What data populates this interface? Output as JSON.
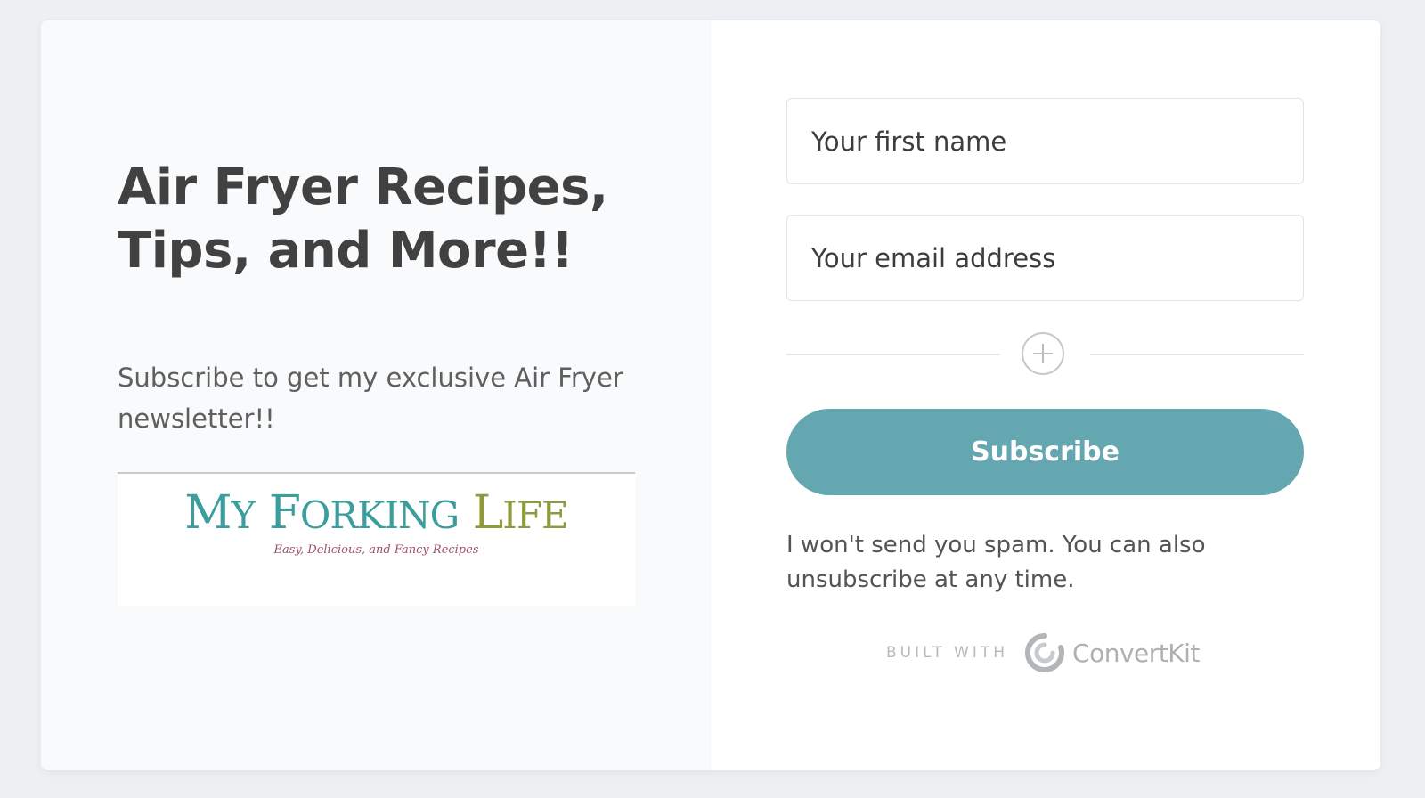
{
  "form": {
    "headline_line1": "Air Fryer Recipes,",
    "headline_line2": "Tips, and More!!",
    "subtext": "Subscribe to get my exclusive Air Fryer newsletter!!",
    "logo": {
      "title_my_initial": "M",
      "title_my_rest": "Y",
      "title_forking_initial": "F",
      "title_forking_rest": "ORKING",
      "title_life_initial": "L",
      "title_life_rest": "IFE",
      "tagline": "Easy, Delicious, and Fancy Recipes"
    },
    "first_name_placeholder": "Your first name",
    "email_placeholder": "Your email address",
    "subscribe_label": "Subscribe",
    "disclaimer": "I won't send you spam. You can also unsubscribe at any time.",
    "built_with_label": "BUILT WITH",
    "built_with_brand": "ConvertKit"
  },
  "icons": {
    "add_field": "plus-icon",
    "brand": "convertkit-logo-icon"
  },
  "colors": {
    "button": "#64a7b0",
    "headline": "#414141",
    "logo_teal": "#3b9d9d",
    "logo_olive": "#8e9a3c",
    "logo_tagline": "#a0506e"
  }
}
